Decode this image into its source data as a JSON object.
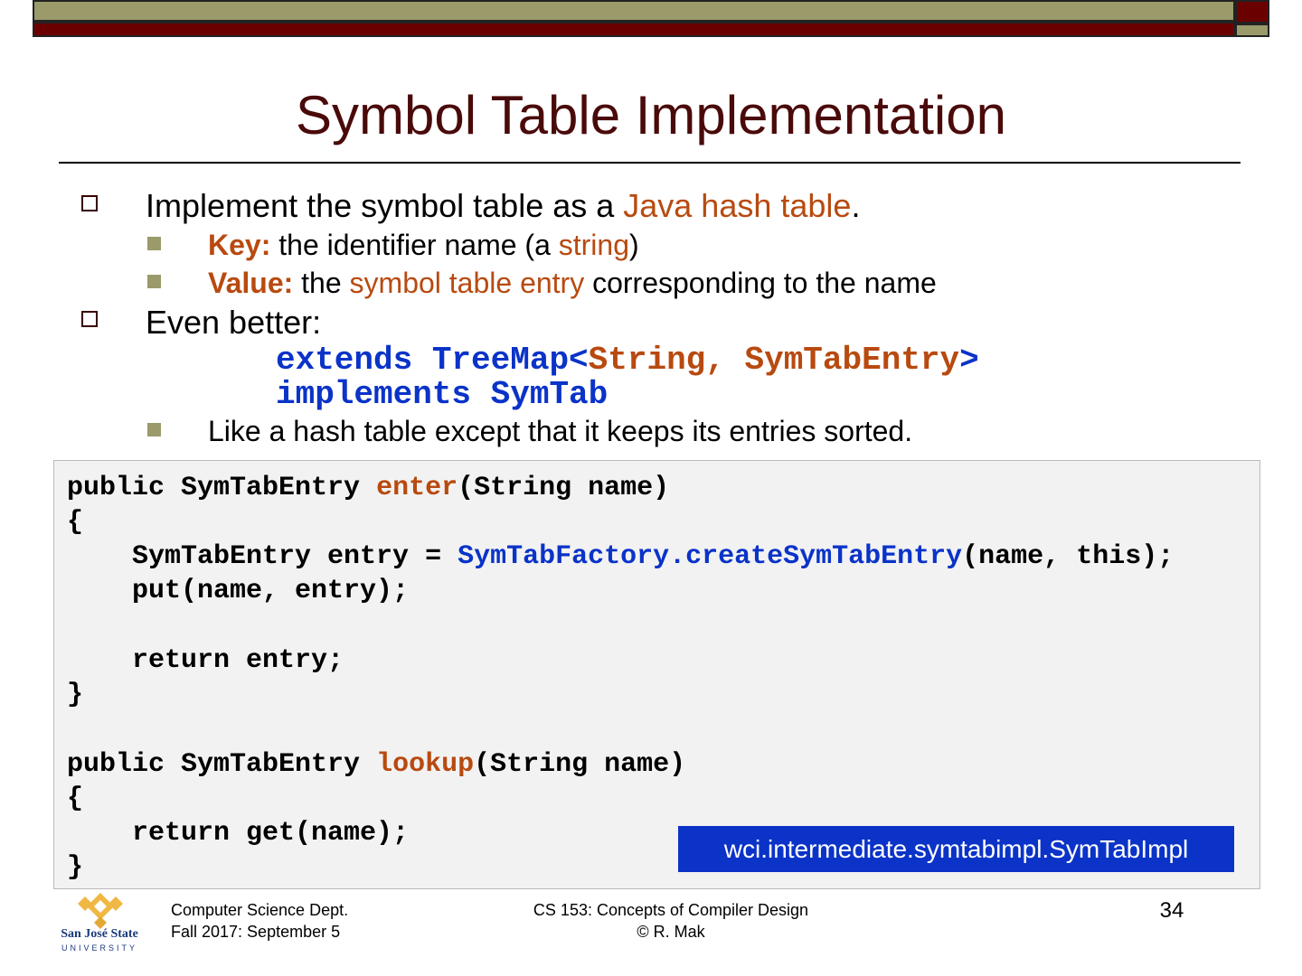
{
  "slide": {
    "title": "Symbol Table Implementation",
    "bullets": {
      "b1": {
        "before": "Implement the symbol table as a ",
        "highlight": "Java hash table",
        "after": "."
      },
      "b1_sub1": {
        "key": "Key:",
        "before": " the identifier name (a ",
        "highlight": "string",
        "after": ")"
      },
      "b1_sub2": {
        "key": "Value:",
        "before": " the ",
        "highlight": "symbol table entry",
        "after": " corresponding to the name"
      },
      "b2": {
        "text": "Even better:"
      },
      "b2_code1": {
        "part1": "extends TreeMap<",
        "part2": "String, SymTabEntry",
        "part3": ">"
      },
      "b2_code2": {
        "text": "implements SymTab"
      },
      "b2_sub1": {
        "text": "Like a hash table except that it keeps its entries sorted."
      }
    },
    "code": {
      "l1": {
        "a": "public SymTabEntry ",
        "b": "enter",
        "c": "(String name)"
      },
      "l2": "{",
      "l3": {
        "a": "    SymTabEntry entry = ",
        "b": "SymTabFactory.createSymTabEntry",
        "c": "(name, this);"
      },
      "l4": "    put(name, entry);",
      "l5": "    return entry;",
      "l6": "}",
      "l7": {
        "a": "public SymTabEntry ",
        "b": "lookup",
        "c": "(String name)"
      },
      "l8": "{",
      "l9": "    return get(name);",
      "l10": "}"
    },
    "package_badge": "wci.intermediate.symtabimpl.SymTabImpl"
  },
  "footer": {
    "logo_line1": "San José State",
    "logo_line2": "UNIVERSITY",
    "dept_line1": "Computer Science Dept.",
    "dept_line2": "Fall 2017: September 5",
    "course_line1": "CS 153: Concepts of Compiler Design",
    "course_line2": "© R. Mak",
    "page_number": "34"
  },
  "colors": {
    "title": "#4a0a0a",
    "highlight": "#b84a10",
    "code_blue": "#0a33c8",
    "bar_olive": "#9a9a6a",
    "bar_red": "#6b0000"
  }
}
